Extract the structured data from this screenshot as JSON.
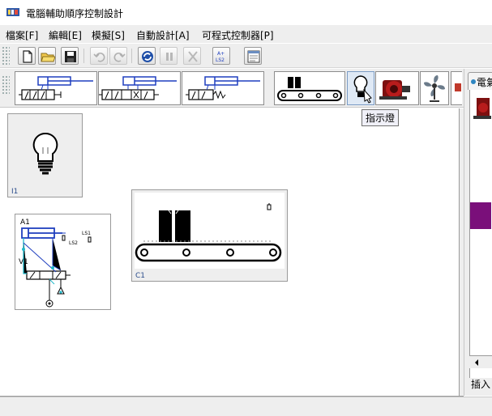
{
  "window": {
    "title": "電腦輔助順序控制設計"
  },
  "menubar": {
    "items": [
      {
        "label": "檔案[F]"
      },
      {
        "label": "編輯[E]"
      },
      {
        "label": "模擬[S]"
      },
      {
        "label": "自動設計[A]"
      },
      {
        "label": "可程式控制器[P]"
      }
    ]
  },
  "toolbar": {
    "ls_button_text": "A+\nLS2",
    "icons": [
      "new-file-icon",
      "open-folder-icon",
      "save-icon",
      "undo-icon",
      "redo-icon",
      "run-icon",
      "pause-icon",
      "stop-icon",
      "ladder-ls-icon",
      "window-icon"
    ]
  },
  "palette": {
    "items": [
      "double-solenoid-cylinder",
      "three-position-cylinder",
      "single-solenoid-cylinder",
      "conveyor",
      "indicator-lamp",
      "motor",
      "fan"
    ],
    "selected": "indicator-lamp"
  },
  "tooltip": {
    "text": "指示燈"
  },
  "canvas": {
    "components": [
      {
        "id": "I1",
        "type": "indicator-lamp"
      },
      {
        "id": "C1",
        "type": "conveyor"
      },
      {
        "id": "A1",
        "type": "cylinder",
        "valve": "V1",
        "switch_labels": [
          "LS1",
          "LS2"
        ]
      }
    ]
  },
  "right_panel": {
    "tab_label": "電氣",
    "bottom_label": "插入"
  },
  "colors": {
    "accent": "#7a0f7a",
    "selection": "#dfe9f5",
    "wire": "#1f3fbf",
    "flow": "#1fb7c9"
  }
}
